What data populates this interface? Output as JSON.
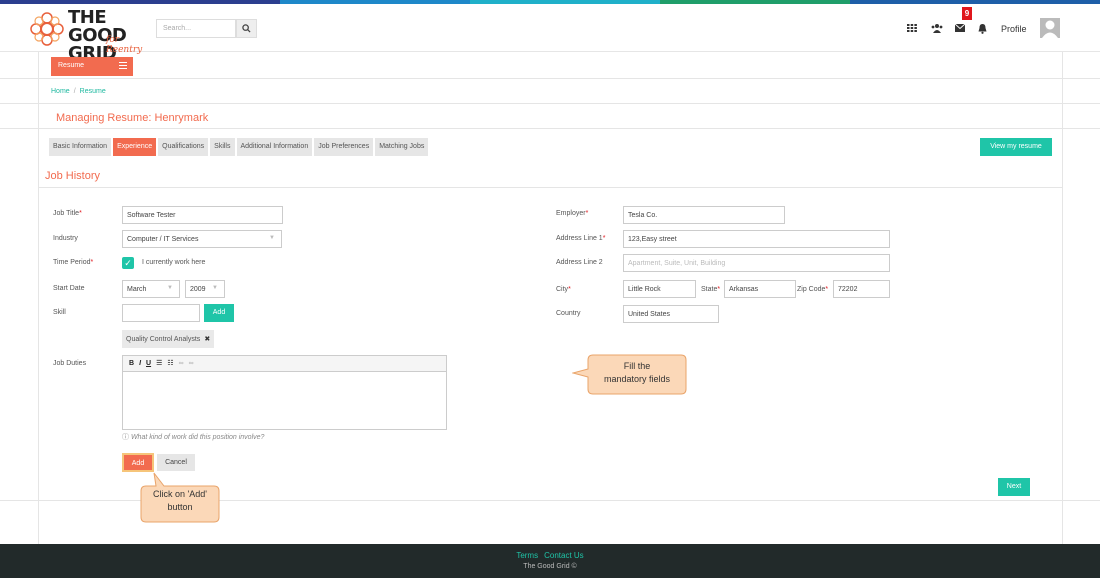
{
  "colors": {
    "accent": "#f26b4f",
    "teal": "#1fc5a8",
    "footer_bg": "#222a2a"
  },
  "header": {
    "logo_text_line1": "THE GOOD",
    "logo_text_line2": "GRID",
    "logo_sub": "for Reentry",
    "search_placeholder": "Search...",
    "notification_count": "9",
    "profile_label": "Profile",
    "icons": [
      "grid-icon",
      "users-icon",
      "envelope-icon",
      "bell-icon",
      "user-avatar-icon"
    ]
  },
  "resume_menu": {
    "label": "Resume"
  },
  "breadcrumb": {
    "home": "Home",
    "current": "Resume"
  },
  "page_title": "Managing Resume: Henrymark",
  "tabs": [
    {
      "label": "Basic Information",
      "active": false
    },
    {
      "label": "Experience",
      "active": true
    },
    {
      "label": "Qualifications",
      "active": false
    },
    {
      "label": "Skills",
      "active": false
    },
    {
      "label": "Additional Information",
      "active": false
    },
    {
      "label": "Job Preferences",
      "active": false
    },
    {
      "label": "Matching Jobs",
      "active": false
    }
  ],
  "view_resume_label": "View my resume",
  "section_title": "Job History",
  "form": {
    "job_title": {
      "label": "Job Title",
      "value": "Software Tester"
    },
    "industry": {
      "label": "Industry",
      "value": "Computer / IT Services"
    },
    "time_period": {
      "label": "Time Period",
      "checkbox_label": "I currently work here"
    },
    "start_date": {
      "label": "Start Date",
      "month": "March",
      "year": "2009"
    },
    "skill": {
      "label": "Skill",
      "add_label": "Add",
      "tag": "Quality Control Analysts"
    },
    "job_duties": {
      "label": "Job Duties",
      "hint": "What kind of work did this position involve?"
    },
    "employer": {
      "label": "Employer",
      "value": "Tesla Co."
    },
    "address1": {
      "label": "Address Line 1",
      "value": "123,Easy street"
    },
    "address2": {
      "label": "Address Line 2",
      "placeholder": "Apartment, Suite, Unit, Building"
    },
    "city": {
      "label": "City",
      "value": "Little Rock"
    },
    "state": {
      "label": "State",
      "value": "Arkansas"
    },
    "zip": {
      "label": "Zip Code",
      "value": "72202"
    },
    "country": {
      "label": "Country",
      "value": "United States"
    },
    "add_button": "Add",
    "cancel_button": "Cancel",
    "next_button": "Next"
  },
  "callouts": {
    "mandatory_line1": "Fill the",
    "mandatory_line2": "mandatory fields",
    "add_line1": "Click on 'Add'",
    "add_line2": "button"
  },
  "footer": {
    "terms": "Terms",
    "contact": "Contact Us",
    "copyright": "The Good Grid ©"
  }
}
